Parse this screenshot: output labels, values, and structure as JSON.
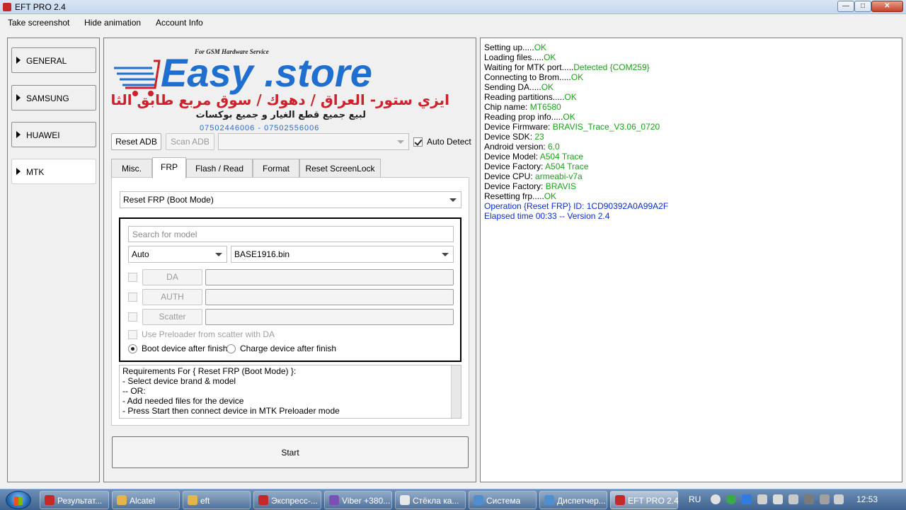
{
  "window": {
    "title": "EFT PRO 2.4"
  },
  "menu": {
    "items": [
      "Take screenshot",
      "Hide animation",
      "Account Info"
    ]
  },
  "nav": {
    "items": [
      "GENERAL",
      "SAMSUNG",
      "HUAWEI",
      "MTK"
    ]
  },
  "logo": {
    "tagline": "For GSM Hardware Service",
    "brand": "Easy .store",
    "arabic_line1": "ايزي ستور- العراق / دهوك / سوق مربع طابق الثالث",
    "arabic_line2": "لبيع جميع قطع الغيار و جميع بوكسات",
    "phones": "07502446006 - 07502556006"
  },
  "toolbar": {
    "reset_adb": "Reset ADB",
    "scan_adb": "Scan ADB",
    "port_value": "",
    "auto_detect": "Auto Detect"
  },
  "tabs": [
    "Misc.",
    "FRP",
    "Flash / Read",
    "Format",
    "Reset ScreenLock"
  ],
  "frp": {
    "operation": "Reset FRP (Boot Mode)",
    "search_placeholder": "Search for model",
    "mode": "Auto",
    "file": "BASE1916.bin",
    "da_label": "DA",
    "auth_label": "AUTH",
    "scatter_label": "Scatter",
    "use_preloader": "Use Preloader from scatter with DA",
    "boot_after": "Boot device after finish",
    "charge_after": "Charge device after finish",
    "requirements": [
      "Requirements For { Reset FRP (Boot Mode) }:",
      " - Select device brand & model",
      "-- OR:",
      " - Add needed files for the device",
      " - Press Start then connect device in MTK Preloader mode"
    ],
    "start": "Start"
  },
  "log": [
    {
      "label": "Setting up.....",
      "value": "OK",
      "color": "green"
    },
    {
      "label": "Loading files.....",
      "value": "OK",
      "color": "green"
    },
    {
      "label": "Waiting for MTK port.....",
      "value": "Detected {COM259}",
      "color": "green"
    },
    {
      "label": "Connecting to Brom.....",
      "value": "OK",
      "color": "green"
    },
    {
      "label": "Sending DA.....",
      "value": "OK",
      "color": "green"
    },
    {
      "label": "Reading partitions.....",
      "value": "OK",
      "color": "green"
    },
    {
      "label": "Chip name: ",
      "value": "MT6580",
      "color": "green"
    },
    {
      "label": "Reading prop info.....",
      "value": "OK",
      "color": "green"
    },
    {
      "label": "Device Firmware: ",
      "value": "BRAVIS_Trace_V3.06_0720",
      "color": "green"
    },
    {
      "label": "Device SDK: ",
      "value": "23",
      "color": "green"
    },
    {
      "label": "Android version: ",
      "value": "6.0",
      "color": "green"
    },
    {
      "label": "Device Model: ",
      "value": "A504 Trace",
      "color": "green"
    },
    {
      "label": "Device Factory: ",
      "value": "A504 Trace",
      "color": "green"
    },
    {
      "label": "Device CPU: ",
      "value": "armeabi-v7a",
      "color": "green"
    },
    {
      "label": "Device Factory: ",
      "value": "BRAVIS",
      "color": "green"
    },
    {
      "label": "Resetting frp.....",
      "value": "OK",
      "color": "green"
    },
    {
      "label": "",
      "value": "Operation {Reset FRP} ID: 1CD90392A0A99A2F",
      "color": "blue"
    },
    {
      "label": "",
      "value": "Elapsed time 00:33 -- Version 2.4",
      "color": "blue"
    }
  ],
  "taskbar": {
    "items": [
      "Результат...",
      "Alcatel",
      "eft",
      "Экспресс-...",
      "Viber +380...",
      "Стёкла ка...",
      "Система",
      "Диспетчер...",
      "EFT PRO 2.4"
    ],
    "language": "RU",
    "clock": "12:53"
  },
  "colors": {
    "log_ok": "#1aa11a",
    "log_info": "#0b2ad6",
    "brand_blue": "#1e6fd0",
    "brand_red": "#d0202a"
  }
}
